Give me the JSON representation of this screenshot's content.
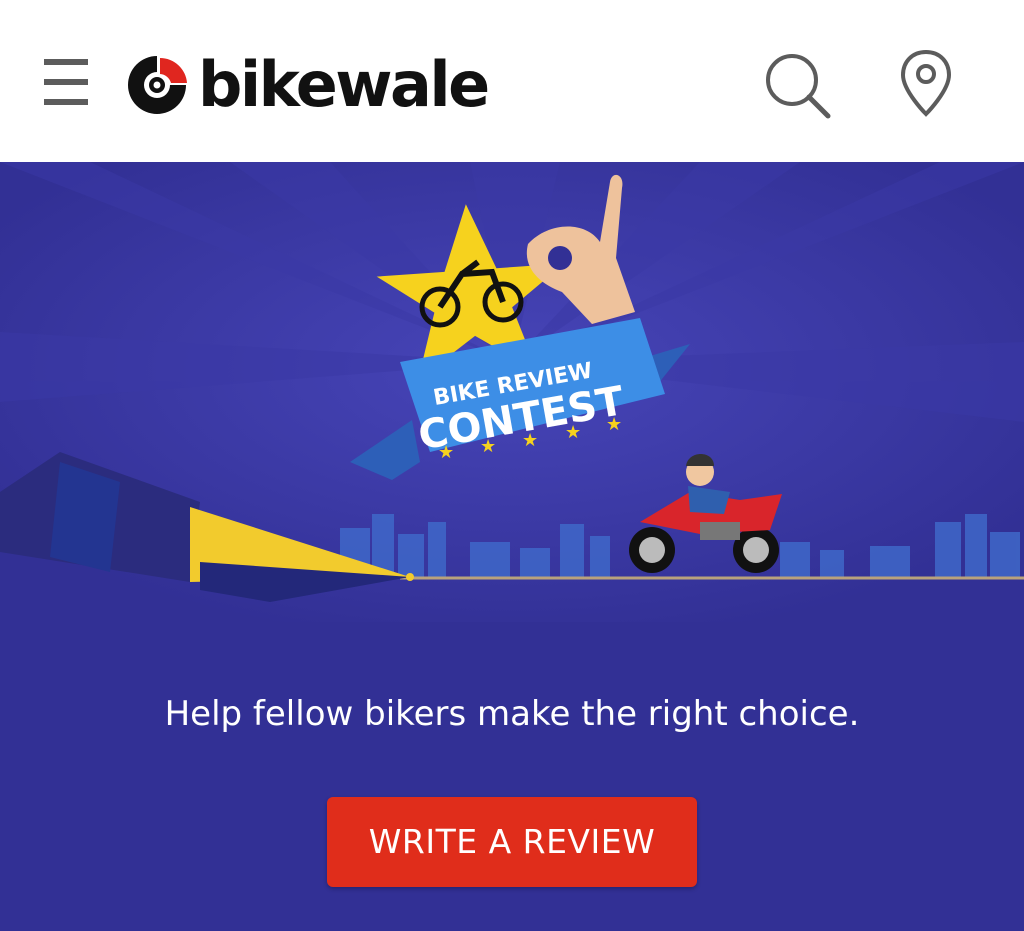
{
  "header": {
    "brand": "bikewale",
    "menu_icon": "hamburger-menu-icon",
    "search_icon": "search-icon",
    "location_icon": "location-pin-icon"
  },
  "banner": {
    "ribbon_top": "BIKE REVIEW",
    "ribbon_main": "CONTEST",
    "tagline": "Help fellow bikers make the right choice.",
    "cta_label": "WRITE A REVIEW"
  },
  "colors": {
    "hero_bg": "#323095",
    "cta_bg": "#e02d1b",
    "star": "#f6d21e",
    "ribbon": "#3d8ee6",
    "brand_red": "#e0261f"
  }
}
